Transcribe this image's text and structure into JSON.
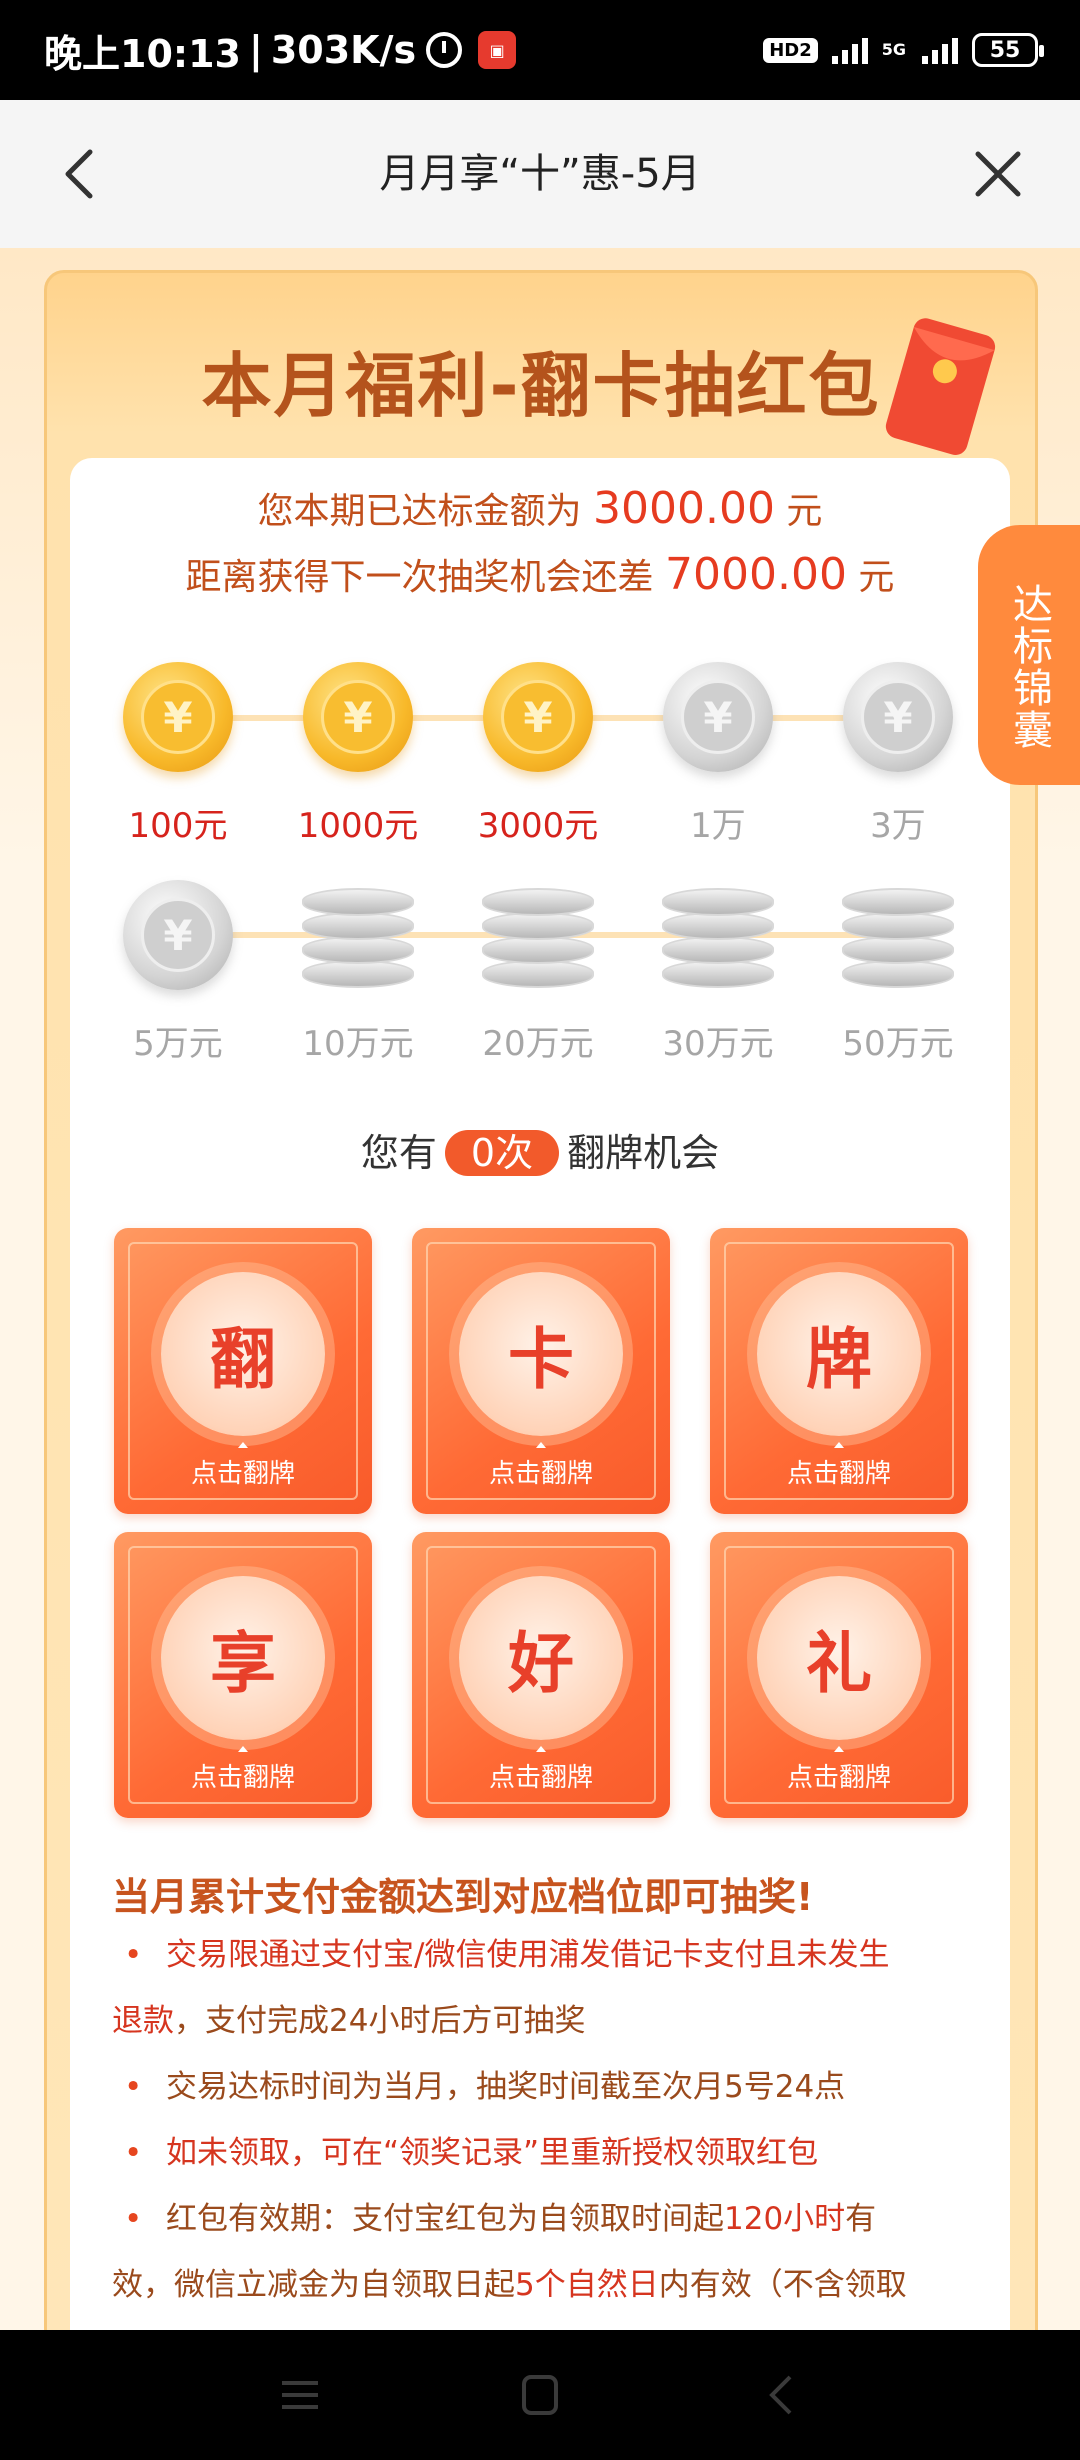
{
  "status_bar": {
    "time": "晚上10:13",
    "separator": "|",
    "speed": "303K/s",
    "hd_badge": "HD2",
    "network": "5G",
    "battery": "55"
  },
  "nav": {
    "title": "月月享“十”惠-5月"
  },
  "banner": {
    "title": "本月福利-翻卡抽红包"
  },
  "summary": {
    "line1_prefix": "您本期已达标金额为",
    "line1_amount": "3000.00",
    "line1_unit": "元",
    "line2_prefix": "距离获得下一次抽奖机会还差",
    "line2_amount": "7000.00",
    "line2_unit": "元"
  },
  "milestones": [
    {
      "label": "100元",
      "achieved": true,
      "icon": "gold-coin-icon"
    },
    {
      "label": "1000元",
      "achieved": true,
      "icon": "gold-coin-icon"
    },
    {
      "label": "3000元",
      "achieved": true,
      "icon": "gold-coin-icon"
    },
    {
      "label": "1万",
      "achieved": false,
      "icon": "silver-coin-icon"
    },
    {
      "label": "3万",
      "achieved": false,
      "icon": "silver-coin-icon"
    },
    {
      "label": "5万元",
      "achieved": false,
      "icon": "silver-coin-icon"
    },
    {
      "label": "10万元",
      "achieved": false,
      "icon": "coin-stack-icon"
    },
    {
      "label": "20万元",
      "achieved": false,
      "icon": "coin-stack-icon"
    },
    {
      "label": "30万元",
      "achieved": false,
      "icon": "coin-stack-icon"
    },
    {
      "label": "50万元",
      "achieved": false,
      "icon": "coin-stack-icon"
    }
  ],
  "chances": {
    "prefix": "您有",
    "count": "0次",
    "suffix": "翻牌机会"
  },
  "cards": [
    {
      "char": "翻",
      "tap": "点击翻牌"
    },
    {
      "char": "卡",
      "tap": "点击翻牌"
    },
    {
      "char": "牌",
      "tap": "点击翻牌"
    },
    {
      "char": "享",
      "tap": "点击翻牌"
    },
    {
      "char": "好",
      "tap": "点击翻牌"
    },
    {
      "char": "礼",
      "tap": "点击翻牌"
    }
  ],
  "rules": {
    "title": "当月累计支付金额达到对应档位即可抽奖!",
    "bullet": "•",
    "r1_a": "交易限通过支付宝/微信使用浦发借记卡支付且未发生",
    "r1_b": "退款",
    "r1_c": "，支付完成24小时后方可抽奖",
    "r2": "交易达标时间为当月，抽奖时间截至次月5号24点",
    "r3": "如未领取，可在“领奖记录”里重新授权领取红包",
    "r4_a": "红包有效期：支付宝红包为自领取时间起",
    "r4_b": "120小时",
    "r4_c": "有",
    "r4_d": "效，微信立减金为自领取日起",
    "r4_e": "5个自然日",
    "r4_f": "内有效（不含领取"
  },
  "side_tab": {
    "label": "达标锦囊"
  },
  "colors": {
    "accent": "#f25a2b",
    "title_brown": "#b4531c",
    "achieved_red": "#d6231c",
    "inactive_gray": "#a6a6a6"
  }
}
